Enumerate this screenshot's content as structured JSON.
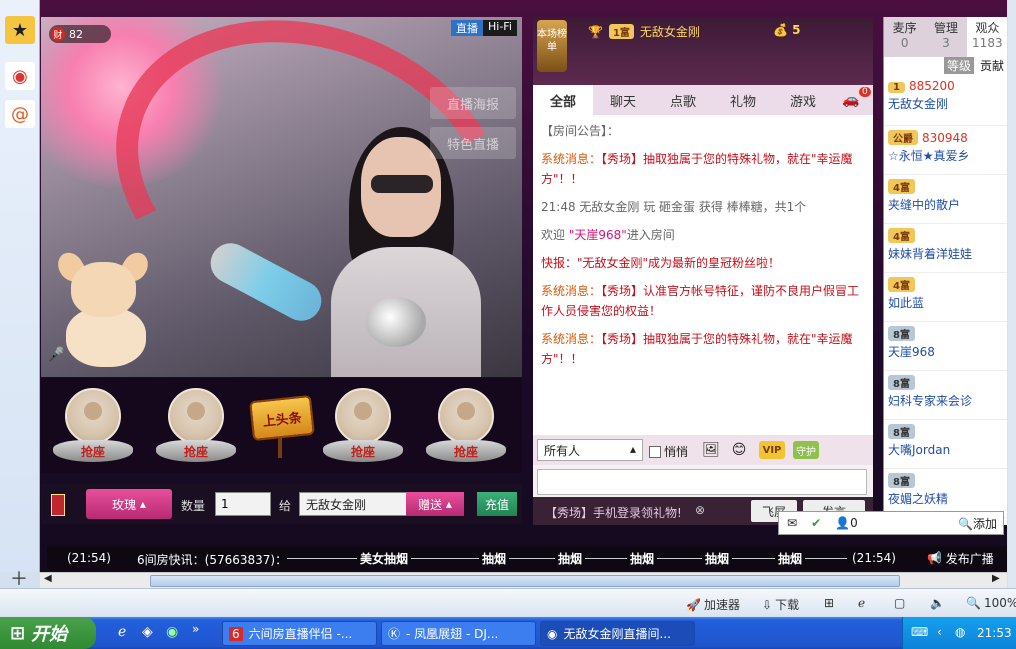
{
  "video": {
    "wealth_label": "财",
    "wealth_value": "82",
    "live_label": "直播",
    "hifi_label": "Hi-Fi",
    "ghost_buttons": [
      "直播海报",
      "特色直播"
    ]
  },
  "seats": {
    "grab_label": "抢座",
    "headline_label": "上头条"
  },
  "gift": {
    "gift_name": "玫瑰",
    "qty_label": "数量",
    "qty_value": "1",
    "give_label": "给",
    "recipient": "无敌女金刚",
    "send_label": "赠送",
    "recharge_label": "充值"
  },
  "chat": {
    "rank_tag": "本场榜单",
    "top_badge": "1富",
    "top_user": "无敌女金刚",
    "coin_count": "5",
    "tabs": [
      "全部",
      "聊天",
      "点歌",
      "礼物",
      "游戏"
    ],
    "car_count": "0",
    "messages": [
      {
        "parts": [
          {
            "c": "gray",
            "t": "【房间公告】："
          }
        ]
      },
      {
        "parts": [
          {
            "c": "sys",
            "t": "系统消息："
          },
          {
            "c": "red",
            "t": "【秀场】抽取独属于您的特殊礼物，就在\"幸运魔方\"！！"
          }
        ]
      },
      {
        "parts": [
          {
            "c": "gray",
            "t": "21:48  无敌女金刚 玩 砸金蛋 获得 "
          },
          {
            "c": "gray",
            "t": " 棒棒糖，共1个"
          }
        ]
      },
      {
        "parts": [
          {
            "c": "gray",
            "t": "欢迎 "
          },
          {
            "c": "mag",
            "t": "\"天崖968\""
          },
          {
            "c": "gray",
            "t": "进入房间"
          }
        ]
      },
      {
        "parts": [
          {
            "c": "red",
            "t": "快报：\"无敌女金刚\"成为最新的皇冠粉丝啦！"
          }
        ]
      },
      {
        "parts": [
          {
            "c": "sys",
            "t": "系统消息："
          },
          {
            "c": "red",
            "t": "【秀场】认准官方帐号特征，谨防不良用户假冒工作人员侵害您的权益！"
          }
        ]
      },
      {
        "parts": [
          {
            "c": "sys",
            "t": "系统消息："
          },
          {
            "c": "red",
            "t": "【秀场】抽取独属于您的特殊礼物，就在\"幸运魔方\"！！"
          }
        ]
      }
    ],
    "to_select": "所有人",
    "whisper_label": "悄悄",
    "vip_label": "VIP",
    "guard_label": "守护",
    "promo": "【秀场】手机登录领礼物!",
    "fly_label": "飞屏",
    "send_label": "发言"
  },
  "users": {
    "tabs": [
      {
        "label": "麦序",
        "count": "0"
      },
      {
        "label": "管理",
        "count": "3"
      },
      {
        "label": "观众",
        "count": "1183"
      }
    ],
    "rank_tabs": [
      "等级",
      "贡献"
    ],
    "list": [
      {
        "badge": "1",
        "value": "885200",
        "name": "无敌女金刚"
      },
      {
        "badge": "公爵",
        "value": "830948",
        "name": "☆永恒★真爱乡"
      },
      {
        "badge": "4富",
        "value": "",
        "name": "夹缝中的散户"
      },
      {
        "badge": "4富",
        "value": "",
        "name": "妹妹背着洋娃娃"
      },
      {
        "badge": "4富",
        "value": "",
        "name": "如此蓝"
      },
      {
        "badge": "8富",
        "value": "",
        "name": "天崖968"
      },
      {
        "badge": "8富",
        "value": "",
        "name": "妇科专家来会诊"
      },
      {
        "badge": "8富",
        "value": "",
        "name": "大嘴Jordan"
      },
      {
        "badge": "8富",
        "value": "",
        "name": "夜媚之妖精"
      }
    ]
  },
  "popup": {
    "count": "0",
    "add_label": "添加"
  },
  "ticker": {
    "time1": "(21:54)",
    "label": "6间房快讯：(57663837)：",
    "words": [
      "美女抽烟",
      "抽烟",
      "抽烟",
      "抽烟",
      "抽烟",
      "抽烟"
    ],
    "time2": "(21:54)",
    "broadcast": "发布广播"
  },
  "statusbar": {
    "accelerator": "加速器",
    "download": "下载",
    "zoom": "100%"
  },
  "taskbar": {
    "start": "开始",
    "tasks": [
      "六间房直播伴侣 -...",
      "- 凤凰展翅 - DJ...",
      "无敌女金刚直播间..."
    ],
    "clock": "21:53"
  }
}
